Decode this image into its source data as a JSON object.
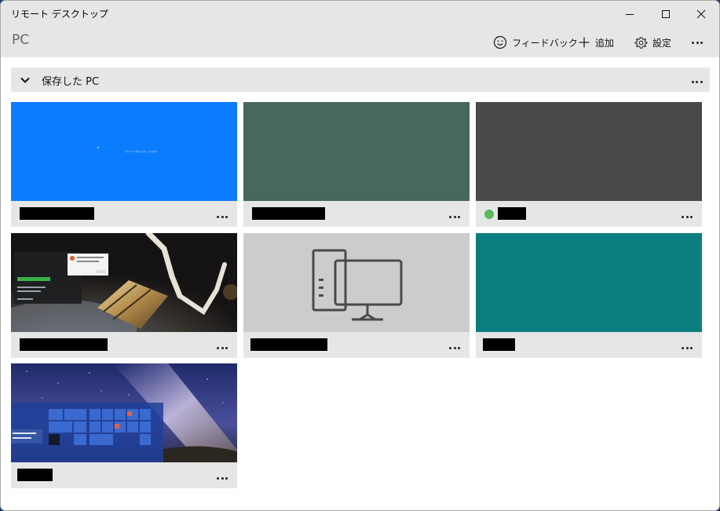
{
  "window": {
    "title": "リモート デスクトップ"
  },
  "app": {
    "title": "PC"
  },
  "commands": {
    "feedback": "フィードバック",
    "add": "追加",
    "settings": "設定"
  },
  "group": {
    "label": "保存した PC"
  },
  "tiles": [
    {
      "thumb": "blue-desktop",
      "thumb_text": "スクリーンをロックしています",
      "status": "none"
    },
    {
      "thumb": "green-solid",
      "status": "none"
    },
    {
      "thumb": "dark-gray-solid",
      "status": "connected"
    },
    {
      "thumb": "space-station-wallpaper",
      "status": "none"
    },
    {
      "thumb": "default-pc-icon",
      "status": "none"
    },
    {
      "thumb": "teal-solid",
      "status": "none"
    },
    {
      "thumb": "milky-way-start-menu",
      "status": "none"
    }
  ],
  "colors": {
    "blue": "#0a7cff",
    "green": "#48675d",
    "darkgray": "#4b4947",
    "teal": "#0b7f7f",
    "placeholder": "#cccccc",
    "online": "#5cb85c"
  },
  "icons": [
    "minimize-icon",
    "maximize-icon",
    "close-icon",
    "smiley-icon",
    "plus-icon",
    "gear-icon",
    "more-icon",
    "chevron-down-icon",
    "desktop-pc-icon"
  ]
}
